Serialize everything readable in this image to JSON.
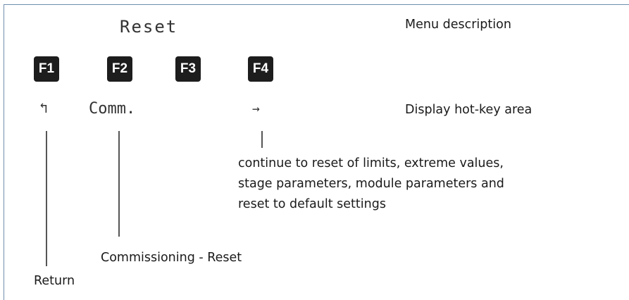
{
  "display": {
    "title": "Reset",
    "fkeys": [
      "F1",
      "F2",
      "F3",
      "F4"
    ],
    "hotkeys": {
      "f1": "↰",
      "f2": "Comm.",
      "f4": "→"
    }
  },
  "legend": {
    "menu_description": "Menu description",
    "hotkey_area": "Display hot-key area"
  },
  "annotations": {
    "f4_lines": [
      "continue to reset of limits, extreme values,",
      "stage parameters, module parameters and",
      "reset to default settings"
    ],
    "f2": "Commissioning - Reset",
    "f1": "Return"
  }
}
